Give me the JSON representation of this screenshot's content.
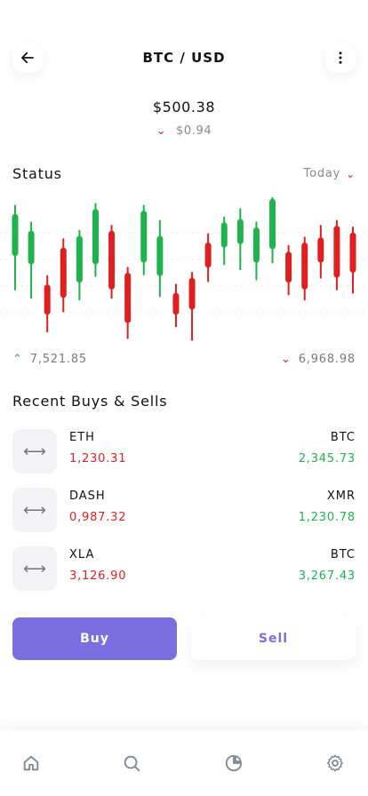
{
  "header": {
    "title": "BTC / USD",
    "back_icon": "arrow-left-icon",
    "more_icon": "more-vertical-icon"
  },
  "ticker": {
    "price": "$500.38",
    "change": "$0.94",
    "change_direction": "down"
  },
  "status": {
    "label": "Status",
    "period_label": "Today"
  },
  "chart_data": {
    "type": "candlestick",
    "colors": {
      "up": "#1fb34d",
      "down": "#e02020"
    },
    "candles": [
      {
        "dir": "up",
        "open": 110,
        "close": 160,
        "high": 170,
        "low": 70
      },
      {
        "dir": "up",
        "open": 100,
        "close": 140,
        "high": 150,
        "low": 60
      },
      {
        "dir": "down",
        "open": 76,
        "close": 40,
        "high": 86,
        "low": 20
      },
      {
        "dir": "down",
        "open": 120,
        "close": 60,
        "high": 130,
        "low": 44
      },
      {
        "dir": "up",
        "open": 78,
        "close": 134,
        "high": 140,
        "low": 58
      },
      {
        "dir": "up",
        "open": 100,
        "close": 166,
        "high": 172,
        "low": 86
      },
      {
        "dir": "down",
        "open": 140,
        "close": 70,
        "high": 146,
        "low": 60
      },
      {
        "dir": "down",
        "open": 90,
        "close": 30,
        "high": 96,
        "low": 12
      },
      {
        "dir": "up",
        "open": 102,
        "close": 164,
        "high": 170,
        "low": 88
      },
      {
        "dir": "up",
        "open": 86,
        "close": 134,
        "high": 152,
        "low": 62
      },
      {
        "dir": "down",
        "open": 66,
        "close": 40,
        "high": 76,
        "low": 26
      },
      {
        "dir": "down",
        "open": 84,
        "close": 46,
        "high": 90,
        "low": 10
      },
      {
        "dir": "down",
        "open": 126,
        "close": 96,
        "high": 136,
        "low": 80
      },
      {
        "dir": "up",
        "open": 120,
        "close": 150,
        "high": 156,
        "low": 100
      },
      {
        "dir": "up",
        "open": 124,
        "close": 154,
        "high": 166,
        "low": 94
      },
      {
        "dir": "up",
        "open": 102,
        "close": 144,
        "high": 150,
        "low": 82
      },
      {
        "dir": "up",
        "open": 118,
        "close": 178,
        "high": 184,
        "low": 102
      },
      {
        "dir": "down",
        "open": 115,
        "close": 78,
        "high": 122,
        "low": 64
      },
      {
        "dir": "down",
        "open": 126,
        "close": 70,
        "high": 132,
        "low": 58
      },
      {
        "dir": "down",
        "open": 132,
        "close": 102,
        "high": 146,
        "low": 84
      },
      {
        "dir": "down",
        "open": 146,
        "close": 84,
        "high": 152,
        "low": 70
      },
      {
        "dir": "down",
        "open": 138,
        "close": 90,
        "high": 144,
        "low": 66
      }
    ],
    "range_low": "7,521.85",
    "range_high": "6,968.98"
  },
  "recent": {
    "title": "Recent Buys & Sells",
    "rows": [
      {
        "left_name": "ETH",
        "left_value": "1,230.31",
        "right_name": "BTC",
        "right_value": "2,345.73"
      },
      {
        "left_name": "DASH",
        "left_value": "0,987.32",
        "right_name": "XMR",
        "right_value": "1,230.78"
      },
      {
        "left_name": "XLA",
        "left_value": "3,126.90",
        "right_name": "BTC",
        "right_value": "3,267.43"
      }
    ],
    "row_icon": "swap-horizontal-icon"
  },
  "actions": {
    "buy_label": "Buy",
    "sell_label": "Sell"
  },
  "nav": {
    "icons": [
      "home-icon",
      "search-icon",
      "pie-chart-icon",
      "settings-icon"
    ]
  }
}
